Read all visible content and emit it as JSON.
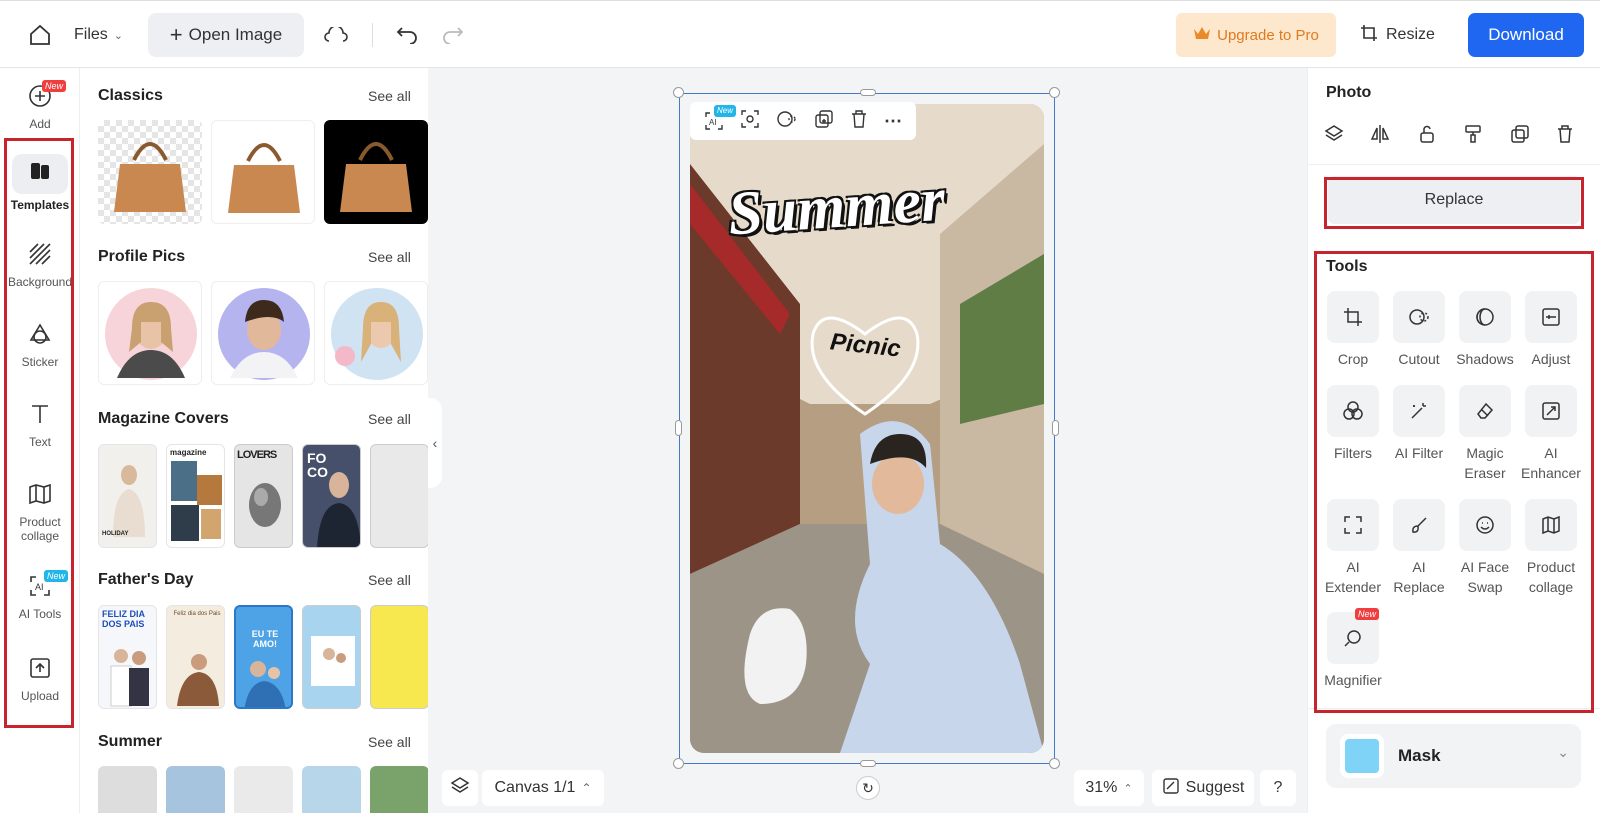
{
  "topbar": {
    "files_label": "Files",
    "open_image_label": "Open Image",
    "upgrade_label": "Upgrade to Pro",
    "resize_label": "Resize",
    "download_label": "Download"
  },
  "leftnav": {
    "new_badge": "New",
    "items": [
      {
        "label": "Add"
      },
      {
        "label": "Templates"
      },
      {
        "label": "Background"
      },
      {
        "label": "Sticker"
      },
      {
        "label": "Text"
      },
      {
        "label": "Product collage"
      },
      {
        "label": "AI Tools"
      },
      {
        "label": "Upload"
      }
    ]
  },
  "templates": {
    "see_all": "See all",
    "sections": [
      {
        "title": "Classics"
      },
      {
        "title": "Profile Pics"
      },
      {
        "title": "Magazine Covers"
      },
      {
        "title": "Father's Day"
      },
      {
        "title": "Summer"
      }
    ],
    "magazine_texts": [
      "HOLIDAY",
      "magazine",
      "LOVERS",
      "FO CO"
    ],
    "fathers_texts": [
      "FELIZ DIA DOS PAIS",
      "Feliz dia dos Pais",
      "EU TE AMO!"
    ]
  },
  "canvas": {
    "headline": "Summer",
    "subline": "Picnic",
    "floatbar_ai_badge": "New",
    "canvas_label": "Canvas 1/1",
    "zoom": "31%",
    "suggest_label": "Suggest",
    "help_label": "?"
  },
  "rightpanel": {
    "photo_title": "Photo",
    "replace_label": "Replace",
    "tools_title": "Tools",
    "tools": [
      {
        "label": "Crop"
      },
      {
        "label": "Cutout"
      },
      {
        "label": "Shadows"
      },
      {
        "label": "Adjust"
      },
      {
        "label": "Filters"
      },
      {
        "label": "AI Filter"
      },
      {
        "label": "Magic Eraser"
      },
      {
        "label": "AI Enhancer"
      },
      {
        "label": "AI Extender"
      },
      {
        "label": "AI Replace"
      },
      {
        "label": "AI Face Swap"
      },
      {
        "label": "Product collage"
      },
      {
        "label": "Magnifier"
      }
    ],
    "magnifier_badge": "New",
    "mask_label": "Mask",
    "mask_color": "#7fd3f7"
  },
  "colors": {
    "accent": "#1f67f0",
    "highlight": "#c8242d",
    "upgrade_bg": "#fde8cd",
    "upgrade_text": "#e07a1e"
  }
}
